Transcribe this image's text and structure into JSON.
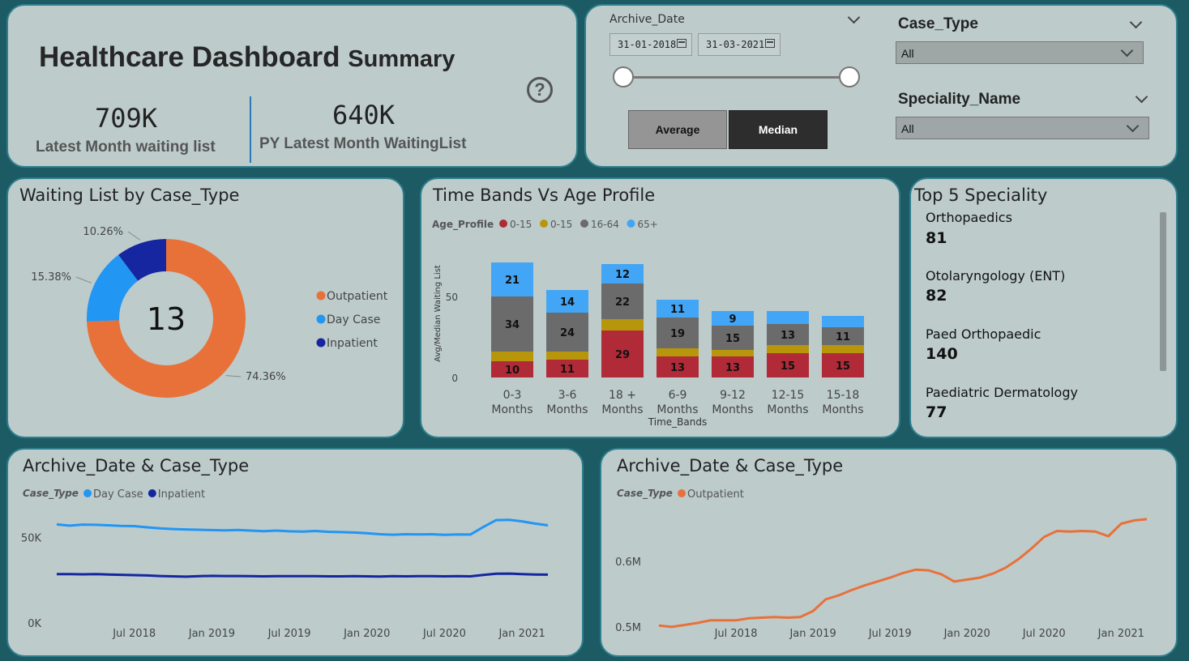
{
  "header": {
    "title": "Healthcare Dashboard",
    "subtitle": "Summary",
    "kpi1_value": "709K",
    "kpi1_label": "Latest Month waiting list",
    "kpi2_value": "640K",
    "kpi2_label": "PY Latest Month WaitingList",
    "help_glyph": "?"
  },
  "filters": {
    "archive_label": "Archive_Date",
    "date_from": "31-01-2018",
    "date_to": "31-03-2021",
    "btn_average": "Average",
    "btn_median": "Median",
    "case_type_label": "Case_Type",
    "case_type_value": "All",
    "speciality_label": "Speciality_Name",
    "speciality_value": "All"
  },
  "donut": {
    "title": "Waiting List by Case_Type",
    "center_value": "13"
  },
  "bars": {
    "title": "Time Bands Vs Age Profile",
    "legend_title": "Age_Profile"
  },
  "top5": {
    "title": "Top 5 Speciality",
    "items": [
      {
        "name": "Orthopaedics",
        "value": "81"
      },
      {
        "name": "Otolaryngology (ENT)",
        "value": "82"
      },
      {
        "name": "Paed Orthopaedic",
        "value": "140"
      },
      {
        "name": "Paediatric Dermatology",
        "value": "77"
      }
    ]
  },
  "line1": {
    "title": "Archive_Date & Case_Type",
    "legend_title": "Case_Type"
  },
  "line2": {
    "title": "Archive_Date & Case_Type",
    "legend_title": "Case_Type"
  },
  "colors": {
    "outpatient": "#e8713a",
    "day_case": "#2196f3",
    "inpatient": "#1526a0",
    "age_0_15_a": "#b02a37",
    "age_0_15_b": "#b8960c",
    "age_16_64": "#6b6b6b",
    "age_65": "#42a5f5"
  },
  "chart_data": [
    {
      "type": "pie",
      "title": "Waiting List by Case_Type",
      "categories": [
        "Outpatient",
        "Day Case",
        "Inpatient"
      ],
      "values": [
        74.36,
        15.38,
        10.26
      ],
      "labels": [
        "74.36%",
        "15.38%",
        "10.26%"
      ],
      "legend": "right"
    },
    {
      "type": "bar",
      "stacked": true,
      "title": "Time Bands Vs Age Profile",
      "xlabel": "Time_Bands",
      "ylabel": "Avg/Median Waiting List",
      "ylim": [
        0,
        70
      ],
      "yticks": [
        "0",
        "50"
      ],
      "categories": [
        [
          "0-3",
          "Months"
        ],
        [
          "3-6",
          "Months"
        ],
        [
          "18 +",
          "Months"
        ],
        [
          "6-9",
          "Months"
        ],
        [
          "9-12",
          "Months"
        ],
        [
          "12-15",
          "Months"
        ],
        [
          "15-18",
          "Months"
        ]
      ],
      "series": [
        {
          "name": "0-15",
          "color": "#b02a37",
          "values": [
            10,
            11,
            29,
            13,
            13,
            15,
            15
          ],
          "labels": [
            "10",
            "11",
            "29",
            "13",
            "13",
            "15",
            "15"
          ]
        },
        {
          "name": "0-15",
          "color": "#b8960c",
          "values": [
            6,
            5,
            7,
            5,
            4,
            5,
            5
          ],
          "labels": [
            "",
            "",
            "",
            "",
            "",
            "",
            ""
          ]
        },
        {
          "name": "16-64",
          "color": "#6b6b6b",
          "values": [
            34,
            24,
            22,
            19,
            15,
            13,
            11
          ],
          "labels": [
            "34",
            "24",
            "22",
            "19",
            "15",
            "13",
            "11"
          ]
        },
        {
          "name": "65+",
          "color": "#42a5f5",
          "values": [
            21,
            14,
            12,
            11,
            9,
            8,
            7
          ],
          "labels": [
            "21",
            "14",
            "12",
            "11",
            "9",
            "",
            ""
          ]
        }
      ],
      "legend": "top-left"
    },
    {
      "type": "line",
      "title": "Archive_Date & Case_Type",
      "legend_title": "Case_Type",
      "ylim": [
        0,
        70000
      ],
      "yticks": [
        {
          "v": 0,
          "label": "0K"
        },
        {
          "v": 50000,
          "label": "50K"
        }
      ],
      "xlim": [
        "2018-01",
        "2021-03"
      ],
      "xticks": [
        {
          "t": "2018-07",
          "label": "Jul 2018"
        },
        {
          "t": "2019-01",
          "label": "Jan 2019"
        },
        {
          "t": "2019-07",
          "label": "Jul 2019"
        },
        {
          "t": "2020-01",
          "label": "Jan 2020"
        },
        {
          "t": "2020-07",
          "label": "Jul 2020"
        },
        {
          "t": "2021-01",
          "label": "Jan 2021"
        }
      ],
      "x": [
        "2018-01",
        "2018-02",
        "2018-03",
        "2018-04",
        "2018-05",
        "2018-06",
        "2018-07",
        "2018-08",
        "2018-09",
        "2018-10",
        "2018-11",
        "2018-12",
        "2019-01",
        "2019-02",
        "2019-03",
        "2019-04",
        "2019-05",
        "2019-06",
        "2019-07",
        "2019-08",
        "2019-09",
        "2019-10",
        "2019-11",
        "2019-12",
        "2020-01",
        "2020-02",
        "2020-03",
        "2020-04",
        "2020-05",
        "2020-06",
        "2020-07",
        "2020-08",
        "2020-09",
        "2020-10",
        "2020-11",
        "2020-12",
        "2021-01",
        "2021-02",
        "2021-03"
      ],
      "series": [
        {
          "name": "Day Case",
          "color": "#2196f3",
          "values": [
            57500,
            56800,
            57400,
            57300,
            57000,
            56600,
            56500,
            55800,
            55200,
            54800,
            54600,
            54400,
            54200,
            54000,
            54300,
            53900,
            53600,
            53900,
            53500,
            53300,
            53700,
            53200,
            53000,
            52800,
            52400,
            51800,
            51500,
            51800,
            51700,
            51800,
            51400,
            51700,
            51600,
            56000,
            60000,
            60200,
            59300,
            58000,
            57000
          ]
        },
        {
          "name": "Inpatient",
          "color": "#1526a0",
          "values": [
            28500,
            28500,
            28400,
            28500,
            28300,
            28100,
            27900,
            27700,
            27400,
            27200,
            27000,
            27300,
            27500,
            27400,
            27400,
            27300,
            27200,
            27300,
            27300,
            27300,
            27300,
            27200,
            27200,
            27300,
            27200,
            27100,
            27300,
            27200,
            27300,
            27300,
            27200,
            27300,
            27200,
            28000,
            28700,
            28800,
            28500,
            28300,
            28200
          ]
        }
      ]
    },
    {
      "type": "line",
      "title": "Archive_Date & Case_Type",
      "legend_title": "Case_Type",
      "ylim": [
        0.49,
        0.67
      ],
      "yticks": [
        {
          "v": 0.5,
          "label": "0.5M"
        },
        {
          "v": 0.6,
          "label": "0.6M"
        }
      ],
      "xlim": [
        "2018-01",
        "2021-03"
      ],
      "xticks": [
        {
          "t": "2018-07",
          "label": "Jul 2018"
        },
        {
          "t": "2019-01",
          "label": "Jan 2019"
        },
        {
          "t": "2019-07",
          "label": "Jul 2019"
        },
        {
          "t": "2020-01",
          "label": "Jan 2020"
        },
        {
          "t": "2020-07",
          "label": "Jul 2020"
        },
        {
          "t": "2021-01",
          "label": "Jan 2021"
        }
      ],
      "x": [
        "2018-01",
        "2018-02",
        "2018-03",
        "2018-04",
        "2018-05",
        "2018-06",
        "2018-07",
        "2018-08",
        "2018-09",
        "2018-10",
        "2018-11",
        "2018-12",
        "2019-01",
        "2019-02",
        "2019-03",
        "2019-04",
        "2019-05",
        "2019-06",
        "2019-07",
        "2019-08",
        "2019-09",
        "2019-10",
        "2019-11",
        "2019-12",
        "2020-01",
        "2020-02",
        "2020-03",
        "2020-04",
        "2020-05",
        "2020-06",
        "2020-07",
        "2020-08",
        "2020-09",
        "2020-10",
        "2020-11",
        "2020-12",
        "2021-01",
        "2021-02",
        "2021-03"
      ],
      "series": [
        {
          "name": "Outpatient",
          "color": "#e8713a",
          "values": [
            0.502,
            0.5,
            0.503,
            0.506,
            0.51,
            0.51,
            0.51,
            0.513,
            0.514,
            0.515,
            0.514,
            0.515,
            0.524,
            0.542,
            0.548,
            0.556,
            0.563,
            0.569,
            0.575,
            0.582,
            0.587,
            0.586,
            0.58,
            0.569,
            0.572,
            0.575,
            0.581,
            0.59,
            0.603,
            0.619,
            0.637,
            0.646,
            0.645,
            0.646,
            0.645,
            0.638,
            0.657,
            0.662,
            0.664
          ]
        }
      ]
    }
  ]
}
